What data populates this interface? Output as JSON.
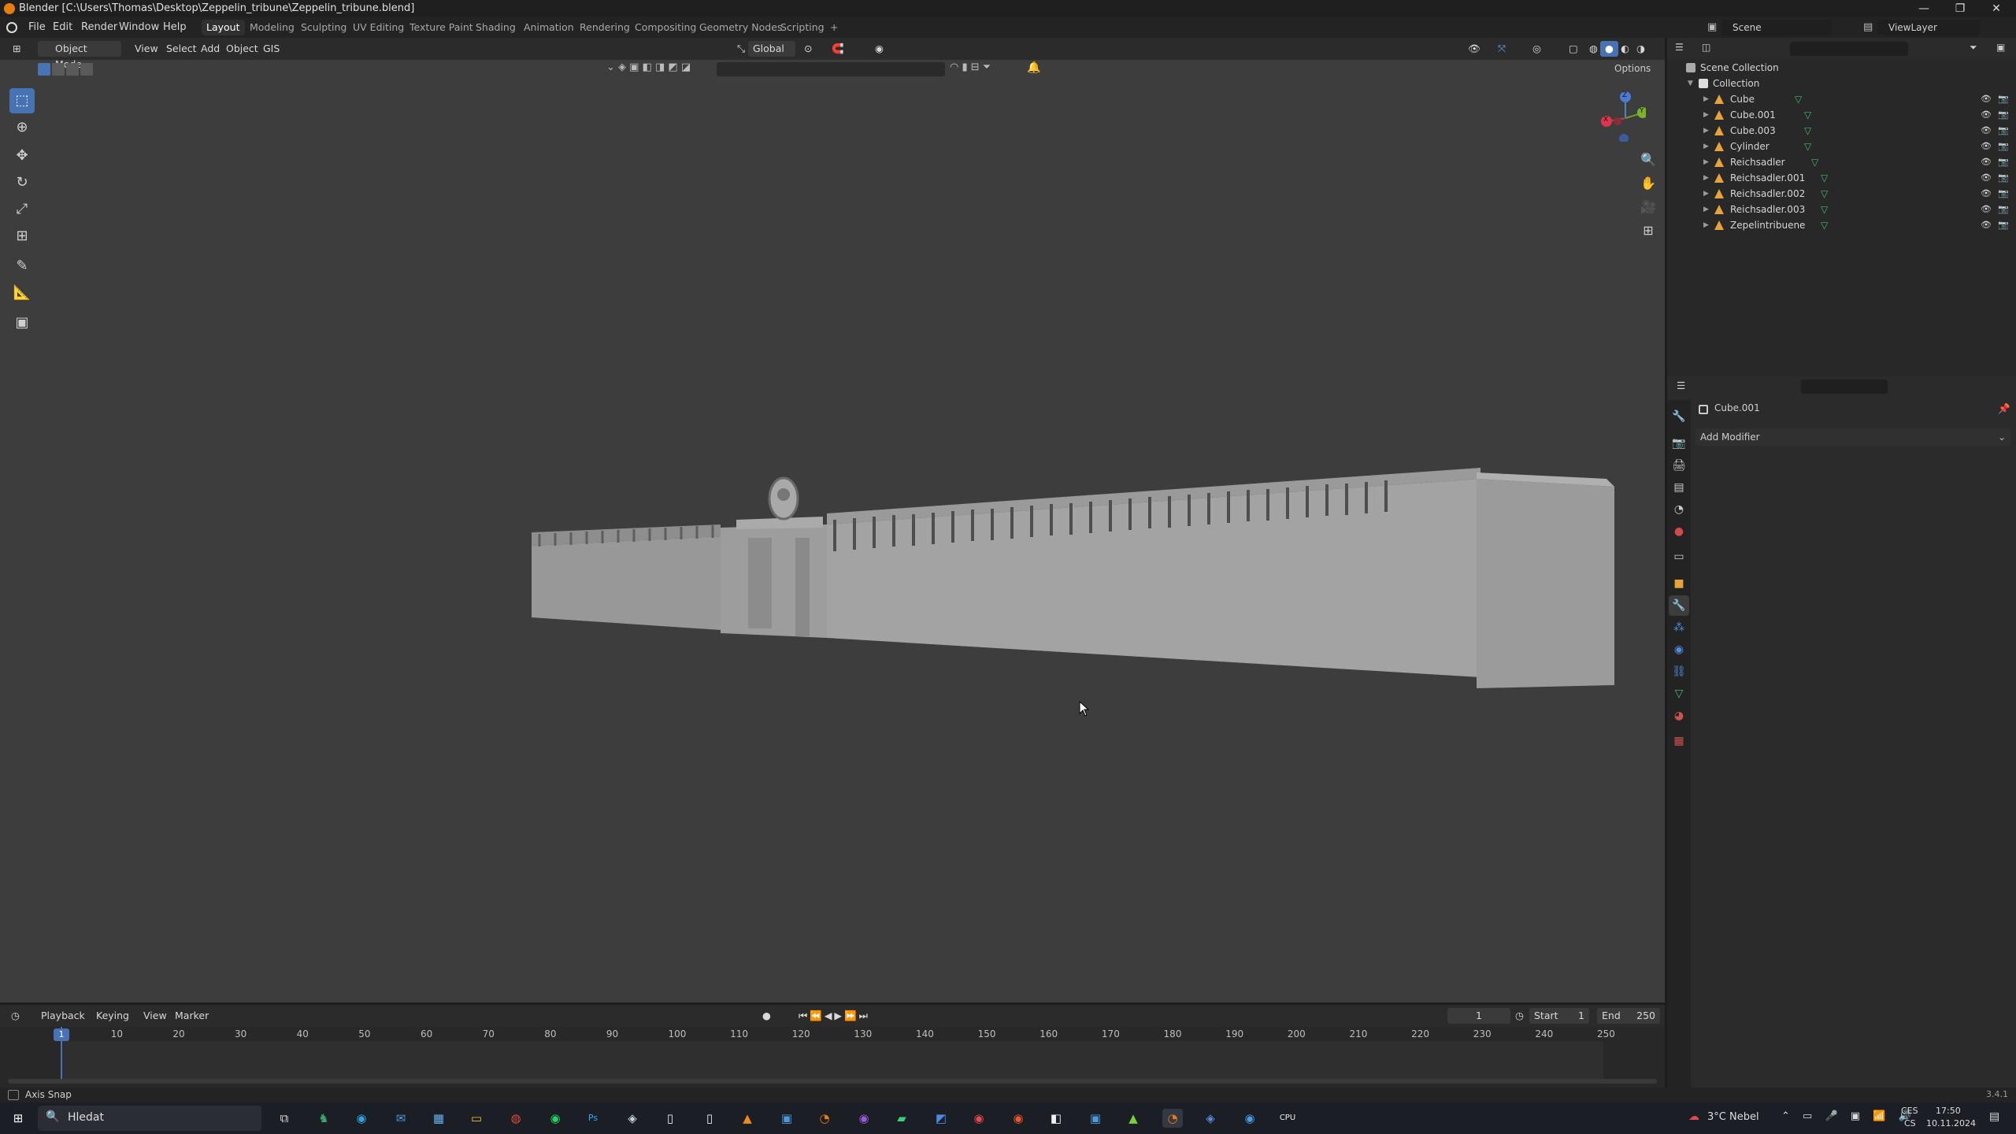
{
  "window": {
    "title": "Blender [C:\\Users\\Thomas\\Desktop\\Zeppelin_tribune\\Zeppelin_tribune.blend]",
    "controls": [
      "—",
      "❐",
      "✕"
    ]
  },
  "menubar": {
    "menus": [
      "File",
      "Edit",
      "Render",
      "Window",
      "Help"
    ],
    "workspaces": [
      "Layout",
      "Modeling",
      "Sculpting",
      "UV Editing",
      "Texture Paint",
      "Shading",
      "Animation",
      "Rendering",
      "Compositing",
      "Geometry Nodes",
      "Scripting",
      "+"
    ],
    "active_workspace": "Layout",
    "scene": "Scene",
    "view_layer": "ViewLayer"
  },
  "viewport": {
    "mode": "Object Mode",
    "menus": [
      "View",
      "Select",
      "Add",
      "Object",
      "GIS"
    ],
    "transform_orientation": "Global",
    "options_label": "Options",
    "gizmo_axes": [
      "Z",
      "X",
      "Y"
    ],
    "background_color": "#3d3d3d",
    "model_color": "#a7a7a7"
  },
  "outliner": {
    "root": "Scene Collection",
    "collection": "Collection",
    "objects": [
      "Cube",
      "Cube.001",
      "Cube.003",
      "Cylinder",
      "Reichsadler",
      "Reichsadler.001",
      "Reichsadler.002",
      "Reichsadler.003",
      "Zepelintribuene"
    ]
  },
  "properties": {
    "object_name": "Cube.001",
    "add_modifier_label": "Add Modifier"
  },
  "timeline": {
    "menus": [
      "Playback",
      "Keying",
      "View",
      "Marker"
    ],
    "current_frame": "1",
    "start_label": "Start",
    "start_value": "1",
    "end_label": "End",
    "end_value": "250",
    "ticks": [
      "1",
      "10",
      "20",
      "30",
      "40",
      "50",
      "60",
      "70",
      "80",
      "90",
      "100",
      "110",
      "120",
      "130",
      "140",
      "150",
      "160",
      "170",
      "180",
      "190",
      "200",
      "210",
      "220",
      "230",
      "240",
      "250"
    ]
  },
  "statusbar": {
    "left": "Axis Snap",
    "version": "3.4.1"
  },
  "taskbar": {
    "search_placeholder": "Hledat",
    "weather": "3°C  Nebel",
    "lang_top": "CES",
    "lang_bottom": "CS",
    "time": "17:50",
    "date": "10.11.2024"
  }
}
